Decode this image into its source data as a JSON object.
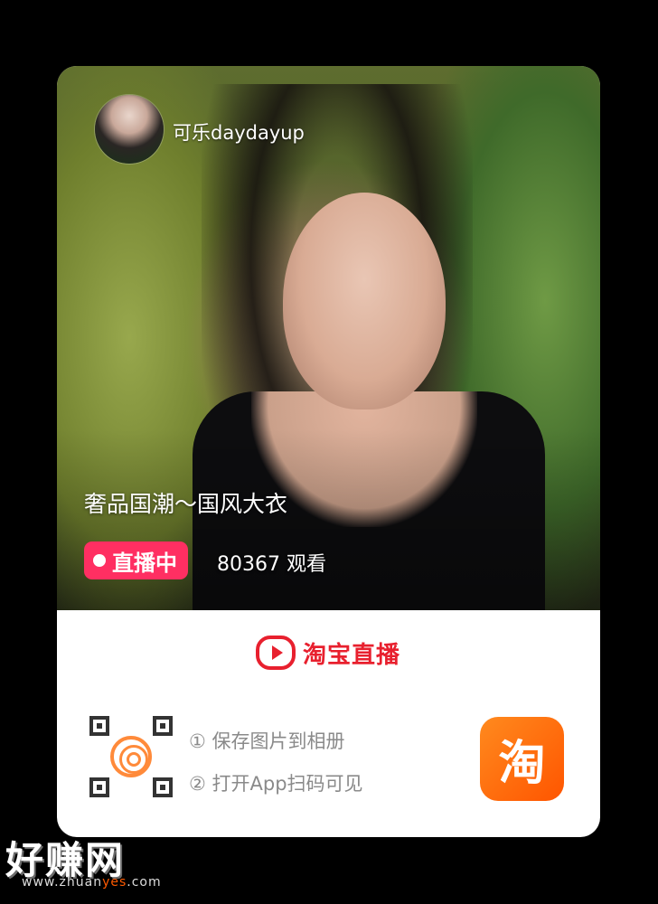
{
  "card": {
    "host": {
      "name": "可乐daydayup"
    },
    "live": {
      "title": "奢品国潮～国风大衣",
      "badge": "直播中",
      "viewers": "80367 观看"
    },
    "brand": {
      "name": "淘宝直播",
      "icon": "play-icon",
      "color": "#e8202e"
    },
    "steps": [
      "① 保存图片到相册",
      "② 打开App扫码可见"
    ],
    "app_icon": {
      "glyph": "淘",
      "icon": "taobao-app-icon"
    }
  },
  "watermark": {
    "main": "好赚网",
    "url_pre": "www.zhuan",
    "url_hl": "yes",
    "url_post": ".com"
  },
  "colors": {
    "live_badge": "#ff2f62",
    "taobao_orange": "#ff5500"
  }
}
